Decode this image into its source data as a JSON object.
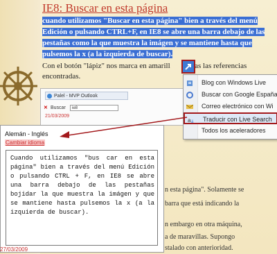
{
  "post": {
    "title": "IE8: Buscar en esta página",
    "selected_lines": [
      "cuando utilizamos \"Buscar en esta página\" bien a través del menú",
      "Edición o pulsando CTRL+F, en IE8 se abre una barra debajo de las",
      "pestañas como la que muestra la imágen y se mantiene hasta que",
      "pulsemos la x (a la izquierda de buscar)."
    ],
    "body_line1_pre": "Con el botón \"lápiz\" nos marca en amarill",
    "body_line1_post": "das las referencias",
    "body_line2": "encontradas."
  },
  "browser": {
    "tab_title": "Palel - MVP Outlook",
    "find_label": "Buscar",
    "find_value": "ie8",
    "date": "21/03/2009"
  },
  "context_menu": {
    "items": [
      {
        "label": "Blog con Windows Live",
        "icon": "blog-icon"
      },
      {
        "label": "Buscar con Google España",
        "icon": "google-icon"
      },
      {
        "label": "Correo electrónico con Wi",
        "icon": "mail-icon"
      },
      {
        "label": "Traducir con Live Search",
        "icon": "translate-icon"
      },
      {
        "label": "Todos los aceleradores",
        "icon": ""
      }
    ],
    "highlighted_index": 3
  },
  "translation": {
    "language_pair": "Alemán - Inglés",
    "change_language": "Cambiar idioma",
    "text": "Cuando utilizamos \"bus car en esta página\" bien a través del menú Edición o pulsando CTRL + F, en IE8 se abre una barra debajo de las pestañas bojidar la que muestra la imágen y que se mantiene hasta pulsemos la x (a la izquierda de buscar).",
    "date": "27/03/2009"
  },
  "right_fragments": [
    "n esta página\". Solamente se",
    "barra que está indicando la",
    "n embargo en otra máquina,",
    "a de maravillas. Supongo",
    "stalado con anterioridad."
  ],
  "colors": {
    "selection": "#3b6fd4",
    "title": "#c0392b",
    "highlight_border": "#a3191c"
  }
}
